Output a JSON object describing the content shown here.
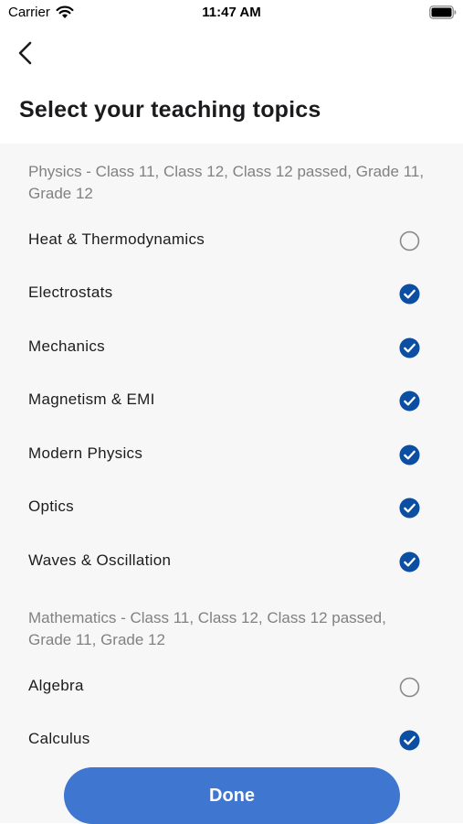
{
  "status_bar": {
    "carrier": "Carrier",
    "time": "11:47 AM",
    "wifi_icon": "wifi-icon",
    "battery_icon": "battery-icon"
  },
  "header": {
    "back_icon": "chevron-left-icon",
    "title": "Select your teaching topics"
  },
  "sections": [
    {
      "header": "Physics - Class 11, Class 12, Class 12 passed, Grade 11, Grade 12",
      "topics": [
        {
          "label": "Heat & Thermodynamics",
          "selected": false
        },
        {
          "label": "Electrostats",
          "selected": true
        },
        {
          "label": "Mechanics",
          "selected": true
        },
        {
          "label": "Magnetism & EMI",
          "selected": true
        },
        {
          "label": "Modern Physics",
          "selected": true
        },
        {
          "label": "Optics",
          "selected": true
        },
        {
          "label": "Waves & Oscillation",
          "selected": true
        }
      ]
    },
    {
      "header": "Mathematics - Class 11, Class 12, Class 12 passed, Grade 11, Grade 12",
      "topics": [
        {
          "label": "Algebra",
          "selected": false
        },
        {
          "label": "Calculus",
          "selected": true
        }
      ]
    }
  ],
  "footer": {
    "done_label": "Done"
  },
  "colors": {
    "accent": "#0b4ea2",
    "button": "#3e76d0",
    "unchecked": "#8a8a8a",
    "section_header": "#818181",
    "list_background": "#f7f7f7"
  }
}
